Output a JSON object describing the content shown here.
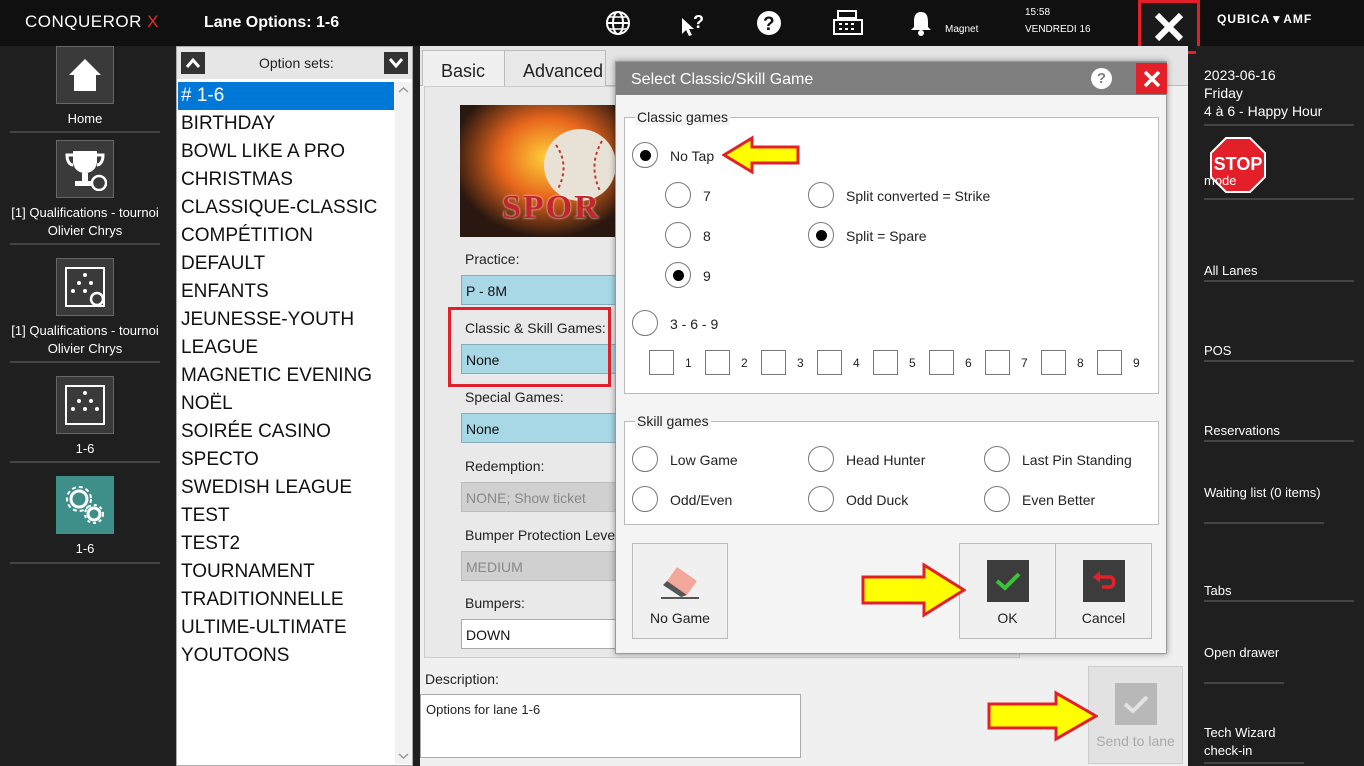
{
  "app": {
    "logo_text": "CONQUEROR",
    "logo_x": "X",
    "window_title": "Lane Options: 1-6",
    "brand": "QUBICA▼AMF"
  },
  "topbar": {
    "user": "Magnet",
    "time": "15:58",
    "day": "VENDREDI 16"
  },
  "left_nav": [
    {
      "label": "Home"
    },
    {
      "label": "[1] Qualifications - tournoi Olivier Chrys"
    },
    {
      "label": "[1] Qualifications - tournoi Olivier Chrys"
    },
    {
      "label": "1-6"
    },
    {
      "label": "1-6"
    }
  ],
  "right_nav": {
    "date": "2023-06-16",
    "weekday": "Friday",
    "session": "4 à 6 - Happy Hour",
    "stop_label": "STOP",
    "stop_mode": "mode",
    "items": [
      "All Lanes",
      "POS",
      "Reservations",
      "Waiting list (0 items)",
      "Tabs",
      "Open drawer",
      "Tech Wizard check-in"
    ]
  },
  "option_sets": {
    "label": "Option sets:",
    "items": [
      "# 1-6",
      "BIRTHDAY",
      "BOWL LIKE A PRO",
      "CHRISTMAS",
      "CLASSIQUE-CLASSIC",
      "COMPÉTITION",
      "DEFAULT",
      "ENFANTS",
      "JEUNESSE-YOUTH",
      "LEAGUE",
      "MAGNETIC EVENING",
      "NOËL",
      "SOIRÉE CASINO",
      "SPECTO",
      "SWEDISH LEAGUE",
      "TEST",
      "TEST2",
      "TOURNAMENT",
      "TRADITIONNELLE",
      "ULTIME-ULTIMATE",
      "YOUTOONS"
    ],
    "selected_index": 0
  },
  "tabs": {
    "basic": "Basic",
    "advanced": "Advanced"
  },
  "basic": {
    "banner_text": "SPOR",
    "practice_label": "Practice:",
    "practice_value": "P - 8M",
    "classic_label": "Classic & Skill Games:",
    "classic_value": "None",
    "special_label": "Special Games:",
    "special_value": "None",
    "redemption_label": "Redemption:",
    "redemption_value": "NONE; Show ticket",
    "bumper_prot_label": "Bumper Protection Level",
    "bumper_prot_value": "MEDIUM",
    "bumpers_label": "Bumpers:",
    "bumpers_value": "DOWN"
  },
  "description": {
    "label": "Description:",
    "value": "Options for lane 1-6"
  },
  "send_to_lane": "Send to lane",
  "dialog": {
    "title": "Select Classic/Skill Game",
    "help": "?",
    "classic_legend": "Classic games",
    "no_tap": "No Tap",
    "opt7": "7",
    "opt8": "8",
    "opt9": "9",
    "split_strike": "Split converted = Strike",
    "split_spare": "Split = Spare",
    "three_six_nine": "3 - 6 - 9",
    "pins": [
      "1",
      "2",
      "3",
      "4",
      "5",
      "6",
      "7",
      "8",
      "9"
    ],
    "skill_legend": "Skill games",
    "low_game": "Low Game",
    "head_hunter": "Head Hunter",
    "last_pin": "Last Pin Standing",
    "odd_even": "Odd/Even",
    "odd_duck": "Odd Duck",
    "even_better": "Even Better",
    "no_game": "No Game",
    "ok": "OK",
    "cancel": "Cancel"
  }
}
